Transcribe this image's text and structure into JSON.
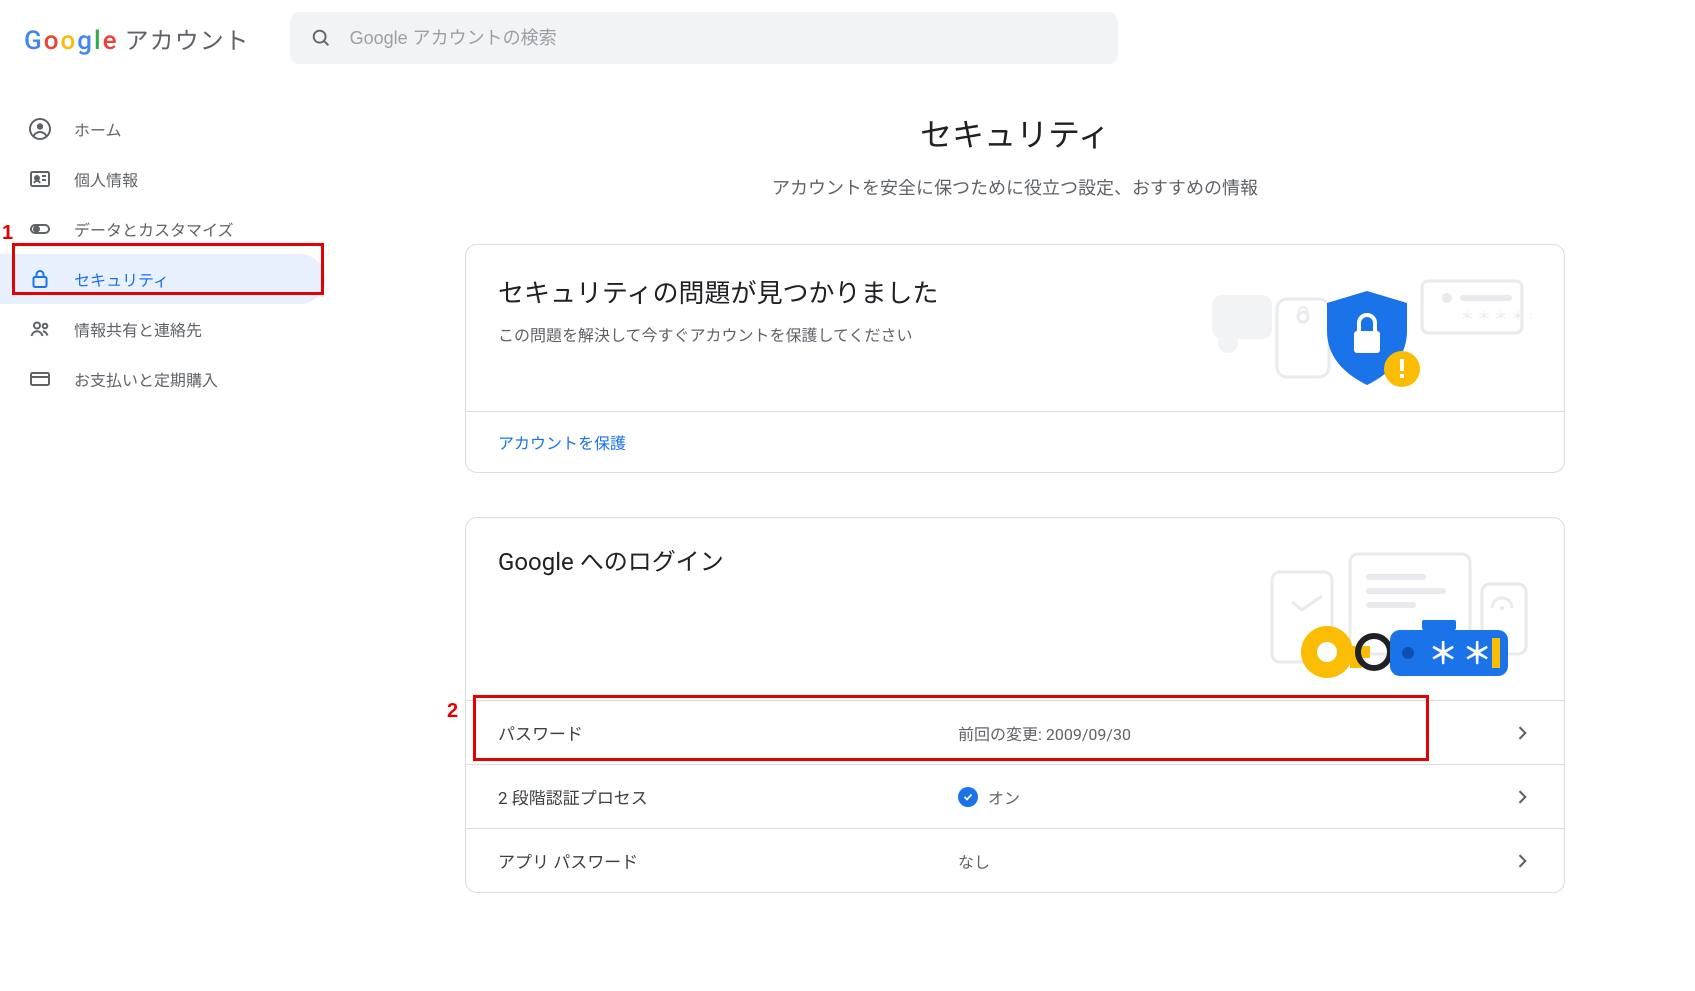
{
  "brand": {
    "product_label": "アカウント"
  },
  "search": {
    "placeholder": "Google アカウントの検索"
  },
  "nav": {
    "items": [
      {
        "label": "ホーム"
      },
      {
        "label": "個人情報"
      },
      {
        "label": "データとカスタマイズ"
      },
      {
        "label": "セキュリティ"
      },
      {
        "label": "情報共有と連絡先"
      },
      {
        "label": "お支払いと定期購入"
      }
    ]
  },
  "page": {
    "title": "セキュリティ",
    "subtitle": "アカウントを安全に保つために役立つ設定、おすすめの情報"
  },
  "card_issue": {
    "title": "セキュリティの問題が見つかりました",
    "desc": "この問題を解決して今すぐアカウントを保護してください",
    "action": "アカウントを保護"
  },
  "card_login": {
    "title": "Google へのログイン",
    "rows": [
      {
        "label": "パスワード",
        "value": "前回の変更: 2009/09/30"
      },
      {
        "label": "2 段階認証プロセス",
        "value": "オン",
        "check": true
      },
      {
        "label": "アプリ パスワード",
        "value": "なし"
      }
    ]
  },
  "annotations": {
    "a1": "1",
    "a2": "2"
  }
}
